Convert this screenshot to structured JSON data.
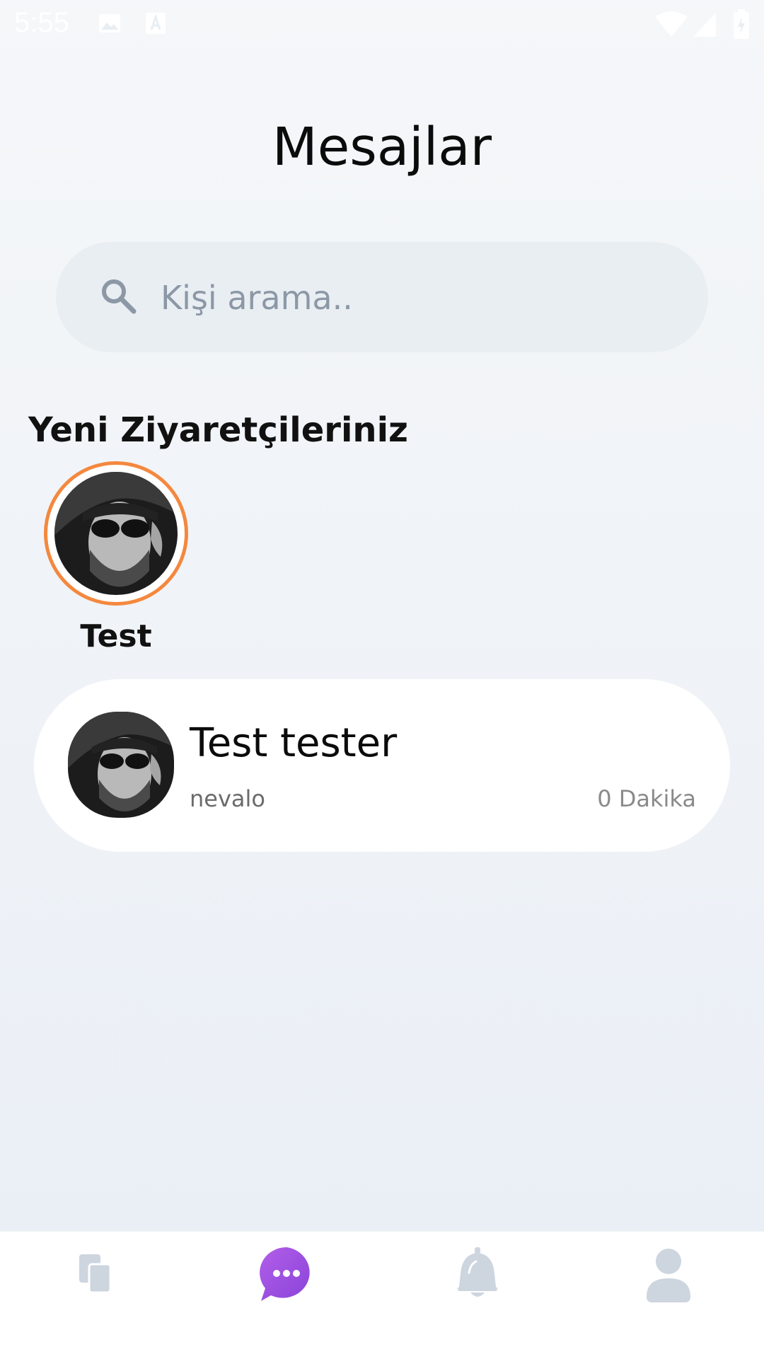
{
  "status_bar": {
    "time": "5:55"
  },
  "header": {
    "title": "Mesajlar"
  },
  "search": {
    "placeholder": "Kişi arama.."
  },
  "visitors": {
    "section_title": "Yeni Ziyaretçileriniz",
    "items": [
      {
        "name": "Test"
      }
    ]
  },
  "chats": [
    {
      "name": "Test tester",
      "subtitle": "nevalo",
      "time": "0 Dakika"
    }
  ],
  "bottom_nav": {
    "items": [
      "documents-icon",
      "messages-icon",
      "notifications-icon",
      "profile-icon"
    ],
    "active_index": 1,
    "active_color": "#9b4de0",
    "inactive_color": "#cdd5df"
  },
  "colors": {
    "visitor_ring": "#f4883e",
    "accent": "#9b4de0"
  }
}
